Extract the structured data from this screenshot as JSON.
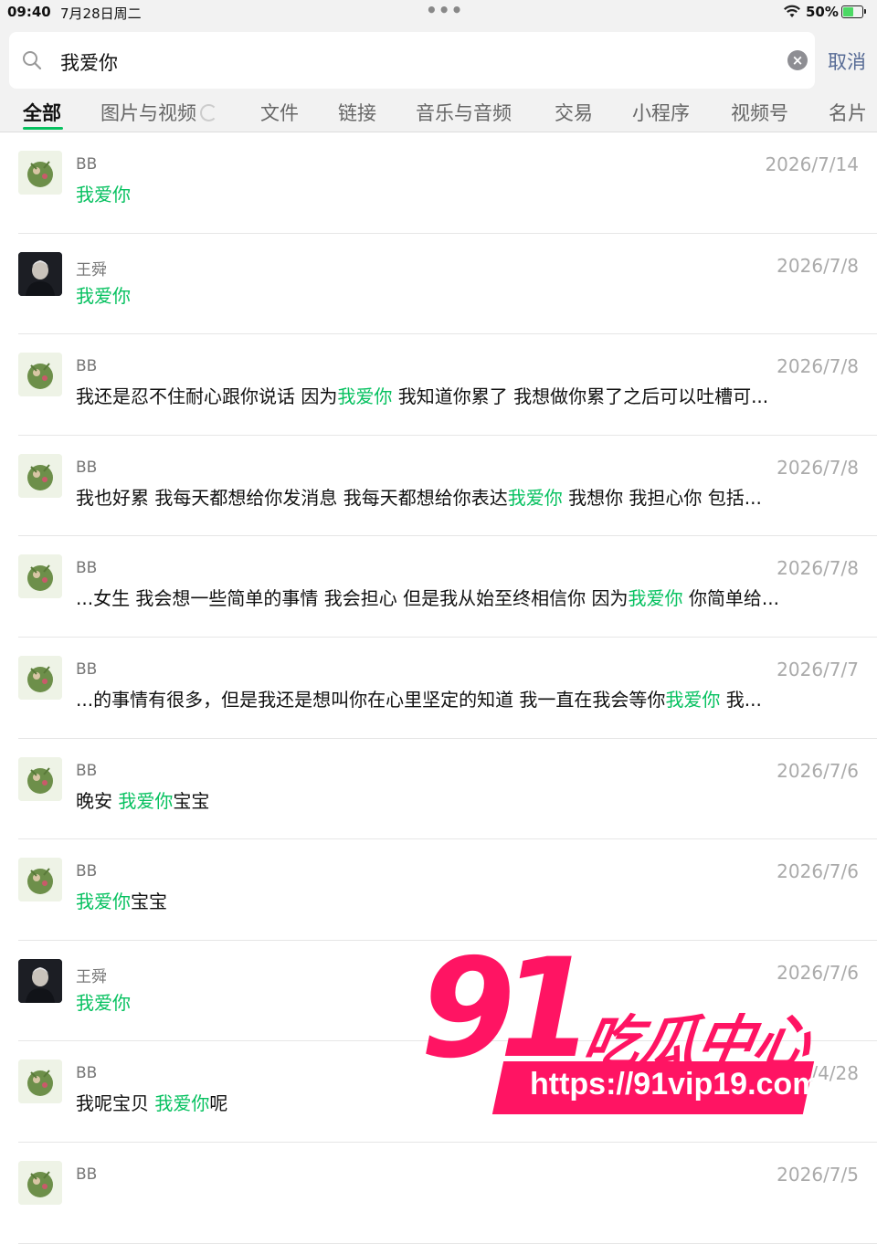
{
  "status_bar": {
    "time": "09:40",
    "date": "7月28日周二",
    "battery": "50%"
  },
  "search": {
    "query": "我爱你",
    "cancel_label": "取消"
  },
  "tabs": [
    {
      "label": "全部"
    },
    {
      "label": "图片与视频"
    },
    {
      "label": "文件"
    },
    {
      "label": "链接"
    },
    {
      "label": "音乐与音频"
    },
    {
      "label": "交易"
    },
    {
      "label": "小程序"
    },
    {
      "label": "视频号"
    },
    {
      "label": "名片"
    }
  ],
  "results": [
    {
      "sender": "BB",
      "date": "2026/7/14",
      "avatar": "bb",
      "before": "",
      "match": "我爱你",
      "after": ""
    },
    {
      "sender": "王舜",
      "date": "2026/7/8",
      "avatar": "ws",
      "before": "",
      "match": "我爱你",
      "after": ""
    },
    {
      "sender": "BB",
      "date": "2026/7/8",
      "avatar": "bb",
      "before": "我还是忍不住耐心跟你说话 因为",
      "match": "我爱你",
      "after": " 我知道你累了 我想做你累了之后可以吐槽可..."
    },
    {
      "sender": "BB",
      "date": "2026/7/8",
      "avatar": "bb",
      "before": "我也好累 我每天都想给你发消息 我每天都想给你表达",
      "match": "我爱你",
      "after": " 我想你 我担心你 包括..."
    },
    {
      "sender": "BB",
      "date": "2026/7/8",
      "avatar": "bb",
      "before": "...女生 我会想一些简单的事情 我会担心 但是我从始至终相信你 因为",
      "match": "我爱你",
      "after": " 你简单给..."
    },
    {
      "sender": "BB",
      "date": "2026/7/7",
      "avatar": "bb",
      "before": "...的事情有很多，但是我还是想叫你在心里坚定的知道 我一直在我会等你",
      "match": "我爱你",
      "after": " 我..."
    },
    {
      "sender": "BB",
      "date": "2026/7/6",
      "avatar": "bb",
      "before": "晚安 ",
      "match": "我爱你",
      "after": "宝宝"
    },
    {
      "sender": "BB",
      "date": "2026/7/6",
      "avatar": "bb",
      "before": "",
      "match": "我爱你",
      "after": "宝宝"
    },
    {
      "sender": "王舜",
      "date": "2026/7/6",
      "avatar": "ws",
      "before": "",
      "match": "我爱你",
      "after": ""
    },
    {
      "sender": "BB",
      "date": "2026/4/28",
      "avatar": "bb",
      "before": "我呢宝贝 ",
      "match": "我爱你",
      "after": "呢"
    },
    {
      "sender": "BB",
      "date": "2026/7/5",
      "avatar": "bb",
      "before": "",
      "match": "",
      "after": ""
    }
  ],
  "watermark": {
    "number": "91",
    "title": "吃瓜中心",
    "url": "https://91vip19.com"
  },
  "colors": {
    "highlight": "#07c160",
    "link": "#576b95",
    "watermark": "#ff1463"
  }
}
